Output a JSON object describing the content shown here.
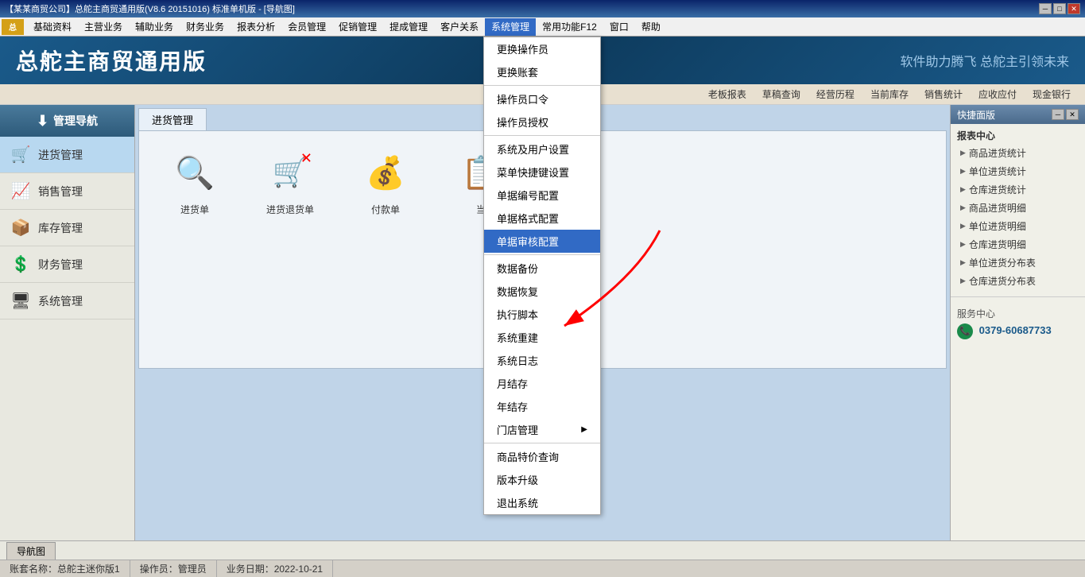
{
  "titlebar": {
    "title": "【某某商贸公司】总舵主商贸通用版(V8.6 20151016) 标准单机版 - [导航图]",
    "minimize": "─",
    "restore": "□",
    "close": "✕"
  },
  "menubar": {
    "logo": "总",
    "items": [
      {
        "id": "basics",
        "label": "基础资料"
      },
      {
        "id": "main-biz",
        "label": "主营业务"
      },
      {
        "id": "aux-biz",
        "label": "辅助业务"
      },
      {
        "id": "finance",
        "label": "财务业务"
      },
      {
        "id": "reports",
        "label": "报表分析"
      },
      {
        "id": "members",
        "label": "会员管理"
      },
      {
        "id": "promotions",
        "label": "促销管理"
      },
      {
        "id": "reminders",
        "label": "提成管理"
      },
      {
        "id": "customers",
        "label": "客户关系"
      },
      {
        "id": "system",
        "label": "系统管理",
        "active": true
      },
      {
        "id": "common",
        "label": "常用功能F12"
      },
      {
        "id": "window",
        "label": "窗口"
      },
      {
        "id": "help",
        "label": "帮助"
      }
    ]
  },
  "header": {
    "brand": "总舵主商贸通用版",
    "slogan": "软件助力腾飞  总舵主引领未来"
  },
  "quicknav": {
    "items": [
      {
        "id": "boss-report",
        "label": "老板报表"
      },
      {
        "id": "draft-query",
        "label": "草稿查询"
      },
      {
        "id": "biz-history",
        "label": "经营历程"
      },
      {
        "id": "current-stock",
        "label": "当前库存"
      },
      {
        "id": "sales-stats",
        "label": "销售统计"
      },
      {
        "id": "receivable",
        "label": "应收应付"
      },
      {
        "id": "cash-bank",
        "label": "现金银行"
      }
    ]
  },
  "sidebar": {
    "header": "管理导航",
    "items": [
      {
        "id": "purchase",
        "label": "进货管理",
        "icon": "🛒",
        "active": true
      },
      {
        "id": "sales",
        "label": "销售管理",
        "icon": "📈"
      },
      {
        "id": "inventory",
        "label": "库存管理",
        "icon": "📦"
      },
      {
        "id": "finance",
        "label": "财务管理",
        "icon": "💲"
      },
      {
        "id": "system",
        "label": "系统管理",
        "icon": "🖥"
      }
    ]
  },
  "main": {
    "tab": "进货管理",
    "icons": [
      {
        "id": "purchase-order",
        "label": "进货单",
        "icon": "🔍"
      },
      {
        "id": "return-order",
        "label": "进货退货单",
        "icon": "🛒"
      },
      {
        "id": "payment",
        "label": "付款单",
        "icon": "💰"
      },
      {
        "id": "current",
        "label": "当",
        "icon": "📋"
      }
    ]
  },
  "dropdown": {
    "title": "系统管理",
    "items": [
      {
        "id": "change-operator",
        "label": "更换操作员",
        "separator": false
      },
      {
        "id": "change-account",
        "label": "更换账套",
        "separator": false
      },
      {
        "id": "sep1",
        "separator": true
      },
      {
        "id": "operator-pwd",
        "label": "操作员口令",
        "separator": false
      },
      {
        "id": "operator-auth",
        "label": "操作员授权",
        "separator": false
      },
      {
        "id": "sep2",
        "separator": true
      },
      {
        "id": "sys-user-settings",
        "label": "系统及用户设置",
        "separator": false
      },
      {
        "id": "menu-shortcuts",
        "label": "菜单快捷键设置",
        "separator": false
      },
      {
        "id": "doc-numbering",
        "label": "单据编号配置",
        "separator": false
      },
      {
        "id": "doc-format",
        "label": "单据格式配置",
        "separator": false
      },
      {
        "id": "doc-audit",
        "label": "单据审核配置",
        "separator": false,
        "highlighted": true
      },
      {
        "id": "sep3",
        "separator": true
      },
      {
        "id": "data-backup",
        "label": "数据备份",
        "separator": false
      },
      {
        "id": "data-restore",
        "label": "数据恢复",
        "separator": false
      },
      {
        "id": "exec-script",
        "label": "执行脚本",
        "separator": false
      },
      {
        "id": "sys-rebuild",
        "label": "系统重建",
        "separator": false
      },
      {
        "id": "sys-log",
        "label": "系统日志",
        "separator": false
      },
      {
        "id": "month-close",
        "label": "月结存",
        "separator": false
      },
      {
        "id": "year-close",
        "label": "年结存",
        "separator": false
      },
      {
        "id": "store-mgmt",
        "label": "门店管理",
        "separator": false,
        "hasArrow": true
      },
      {
        "id": "sep4",
        "separator": true
      },
      {
        "id": "special-price",
        "label": "商品特价查询",
        "separator": false
      },
      {
        "id": "version-upgrade",
        "label": "版本升级",
        "separator": false
      },
      {
        "id": "exit",
        "label": "退出系统",
        "separator": false
      }
    ]
  },
  "quickpanel": {
    "title": "快捷面版",
    "sections": [
      {
        "title": "报表中心",
        "links": [
          "商品进货统计",
          "单位进货统计",
          "仓库进货统计",
          "商品进货明细",
          "单位进货明细",
          "仓库进货明细",
          "单位进货分布表",
          "仓库进货分布表"
        ]
      }
    ],
    "service": {
      "title": "服务中心",
      "phone": "0379-60687733"
    }
  },
  "statusbar": {
    "tab": "导航图"
  },
  "infobar": {
    "account_name_label": "账套名称：总舵主迷你版1",
    "operator_label": "操作员：管理员",
    "date_label": "业务日期：2022-10-21"
  },
  "colors": {
    "header_bg": "#0d3a5c",
    "sidebar_bg": "#e8e8e0",
    "menu_active": "#316ac5",
    "dropdown_highlight": "#316ac5"
  }
}
